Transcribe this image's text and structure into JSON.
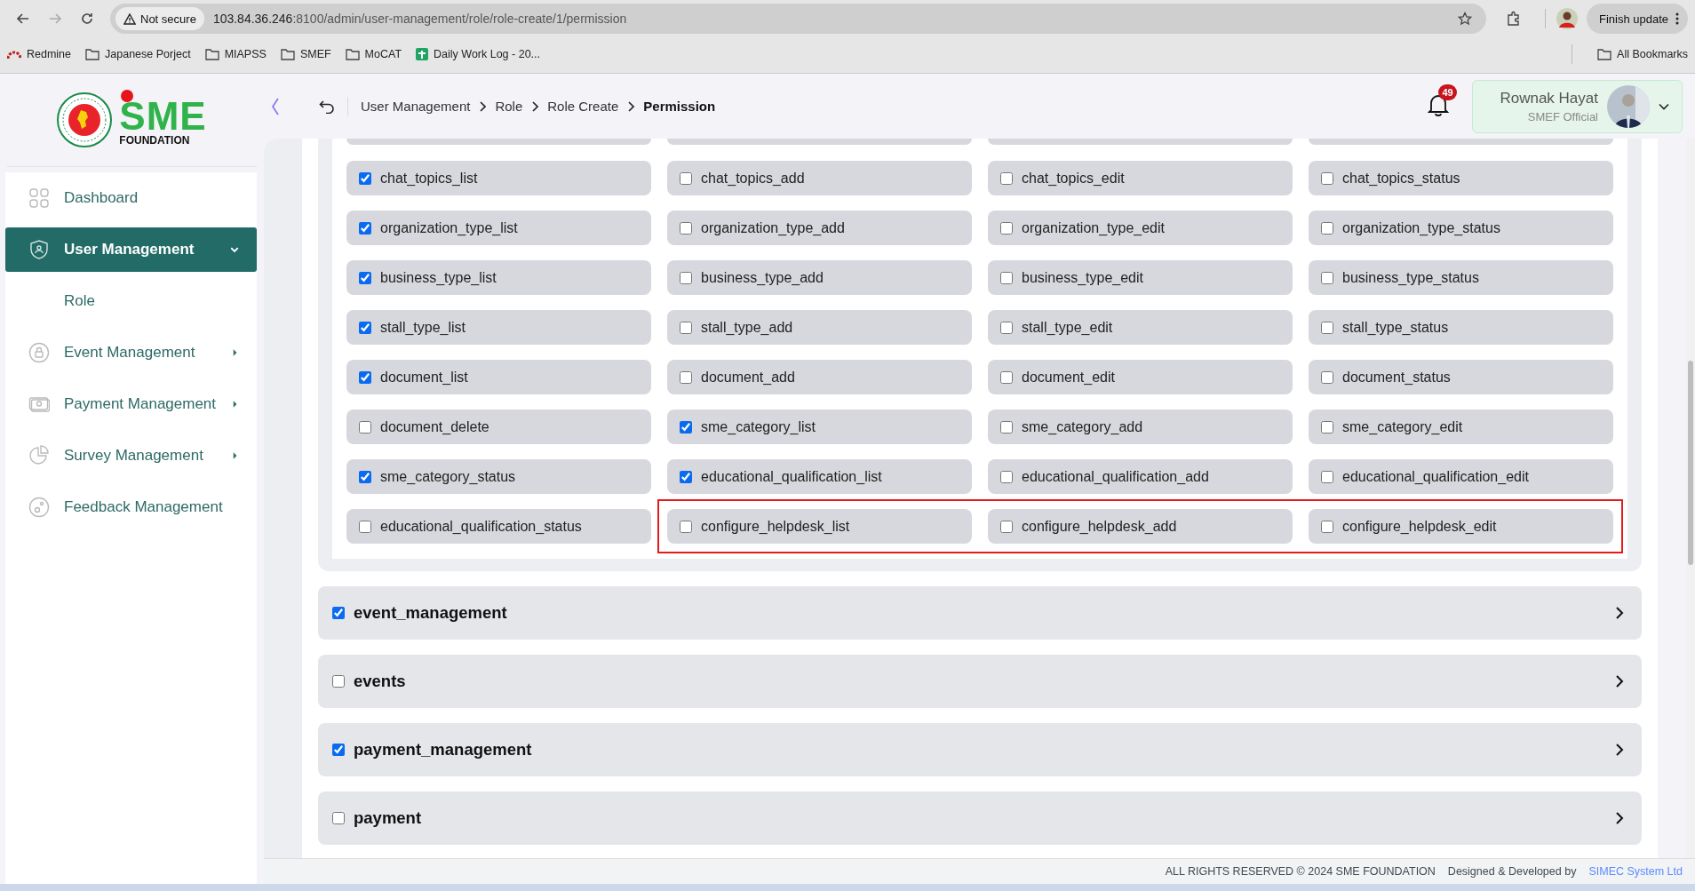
{
  "browser": {
    "security": "Not secure",
    "url_host": "103.84.36.246",
    "url_path": ":8100/admin/user-management/role/role-create/1/permission",
    "update_button": "Finish update",
    "all_bookmarks": "All Bookmarks",
    "bookmarks": [
      {
        "label": "Redmine",
        "kind": "redmine"
      },
      {
        "label": "Japanese Porject",
        "kind": "folder"
      },
      {
        "label": "MIAPSS",
        "kind": "folder"
      },
      {
        "label": "SMEF",
        "kind": "folder"
      },
      {
        "label": "MoCAT",
        "kind": "folder"
      },
      {
        "label": "Daily Work Log - 20...",
        "kind": "sheet"
      }
    ]
  },
  "logo": {
    "letters": "SME",
    "subtitle": "FOUNDATION"
  },
  "sidebar": {
    "items": [
      {
        "label": "Dashboard",
        "selected": false
      },
      {
        "label": "User Management",
        "selected": true,
        "expanded": true,
        "children": [
          {
            "label": "Role"
          }
        ]
      },
      {
        "label": "Event Management",
        "selected": false,
        "expanded": false
      },
      {
        "label": "Payment Management",
        "selected": false,
        "expanded": false
      },
      {
        "label": "Survey Management",
        "selected": false,
        "expanded": false
      },
      {
        "label": "Feedback Management",
        "selected": false
      }
    ]
  },
  "header": {
    "breadcrumb": [
      "User Management",
      "Role",
      "Role Create",
      "Permission"
    ],
    "notification_count": "49",
    "user": {
      "name": "Rownak Hayat",
      "role": "SMEF Official"
    }
  },
  "permission_rows": [
    {
      "cells": [
        {
          "label": "chat_topics_list",
          "checked": true
        },
        {
          "label": "chat_topics_add",
          "checked": false
        },
        {
          "label": "chat_topics_edit",
          "checked": false
        },
        {
          "label": "chat_topics_status",
          "checked": false
        }
      ]
    },
    {
      "cells": [
        {
          "label": "organization_type_list",
          "checked": true
        },
        {
          "label": "organization_type_add",
          "checked": false
        },
        {
          "label": "organization_type_edit",
          "checked": false
        },
        {
          "label": "organization_type_status",
          "checked": false
        }
      ]
    },
    {
      "cells": [
        {
          "label": "business_type_list",
          "checked": true
        },
        {
          "label": "business_type_add",
          "checked": false
        },
        {
          "label": "business_type_edit",
          "checked": false
        },
        {
          "label": "business_type_status",
          "checked": false
        }
      ]
    },
    {
      "cells": [
        {
          "label": "stall_type_list",
          "checked": true
        },
        {
          "label": "stall_type_add",
          "checked": false
        },
        {
          "label": "stall_type_edit",
          "checked": false
        },
        {
          "label": "stall_type_status",
          "checked": false
        }
      ]
    },
    {
      "cells": [
        {
          "label": "document_list",
          "checked": true
        },
        {
          "label": "document_add",
          "checked": false
        },
        {
          "label": "document_edit",
          "checked": false
        },
        {
          "label": "document_status",
          "checked": false
        }
      ]
    },
    {
      "cells": [
        {
          "label": "document_delete",
          "checked": false
        },
        {
          "label": "sme_category_list",
          "checked": true
        },
        {
          "label": "sme_category_add",
          "checked": false
        },
        {
          "label": "sme_category_edit",
          "checked": false
        }
      ]
    },
    {
      "cells": [
        {
          "label": "sme_category_status",
          "checked": true
        },
        {
          "label": "educational_qualification_list",
          "checked": true
        },
        {
          "label": "educational_qualification_add",
          "checked": false
        },
        {
          "label": "educational_qualification_edit",
          "checked": false
        }
      ]
    },
    {
      "cells": [
        {
          "label": "educational_qualification_status",
          "checked": false
        }
      ],
      "highlighted_cells": [
        {
          "label": "configure_helpdesk_list",
          "checked": false
        },
        {
          "label": "configure_helpdesk_add",
          "checked": false
        },
        {
          "label": "configure_helpdesk_edit",
          "checked": false
        }
      ]
    }
  ],
  "sections": [
    {
      "label": "event_management",
      "checked": true
    },
    {
      "label": "events",
      "checked": false
    },
    {
      "label": "payment_management",
      "checked": true
    },
    {
      "label": "payment",
      "checked": false
    }
  ],
  "footer": {
    "copyright": "ALL RIGHTS RESERVED © 2024 SME FOUNDATION",
    "credit": "Designed & Developed by",
    "company": "SIMEC System Ltd"
  }
}
